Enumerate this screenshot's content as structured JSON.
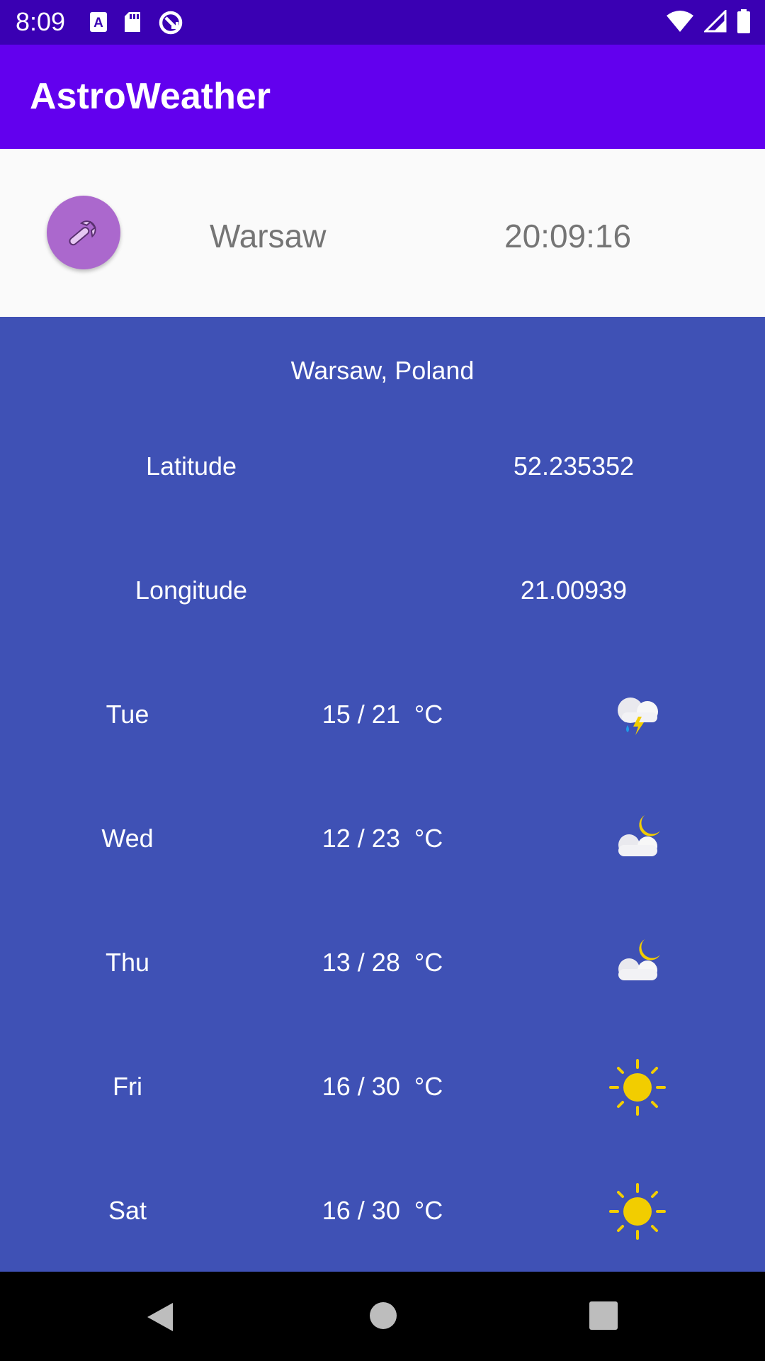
{
  "status_bar": {
    "time": "8:09",
    "left_icons": [
      "a-notification-icon",
      "sd-card-icon",
      "sync-icon"
    ],
    "right_icons": [
      "wifi-icon",
      "cell-signal-icon",
      "battery-icon"
    ]
  },
  "app_bar": {
    "title": "AstroWeather"
  },
  "header": {
    "settings_icon": "wrench-icon",
    "city": "Warsaw",
    "time": "20:09:16"
  },
  "location": {
    "name": "Warsaw, Poland",
    "latitude_label": "Latitude",
    "latitude_value": "52.235352",
    "longitude_label": "Longitude",
    "longitude_value": "21.00939"
  },
  "forecast": [
    {
      "day": "Tue",
      "temp": "15 / 21  °C",
      "icon": "thunderstorm-icon"
    },
    {
      "day": "Wed",
      "temp": "12 / 23  °C",
      "icon": "partly-cloudy-night-icon"
    },
    {
      "day": "Thu",
      "temp": "13 / 28  °C",
      "icon": "partly-cloudy-night-icon"
    },
    {
      "day": "Fri",
      "temp": "16 / 30  °C",
      "icon": "sunny-icon"
    },
    {
      "day": "Sat",
      "temp": "16 / 30  °C",
      "icon": "sunny-icon"
    }
  ],
  "colors": {
    "status_bar": "#3a00b3",
    "app_bar": "#6200ee",
    "panel": "#3f51b5",
    "fab": "#ab68cd",
    "sun": "#f2cd00"
  },
  "nav_bar": {
    "buttons": [
      "back-icon",
      "home-icon",
      "recents-icon"
    ]
  }
}
